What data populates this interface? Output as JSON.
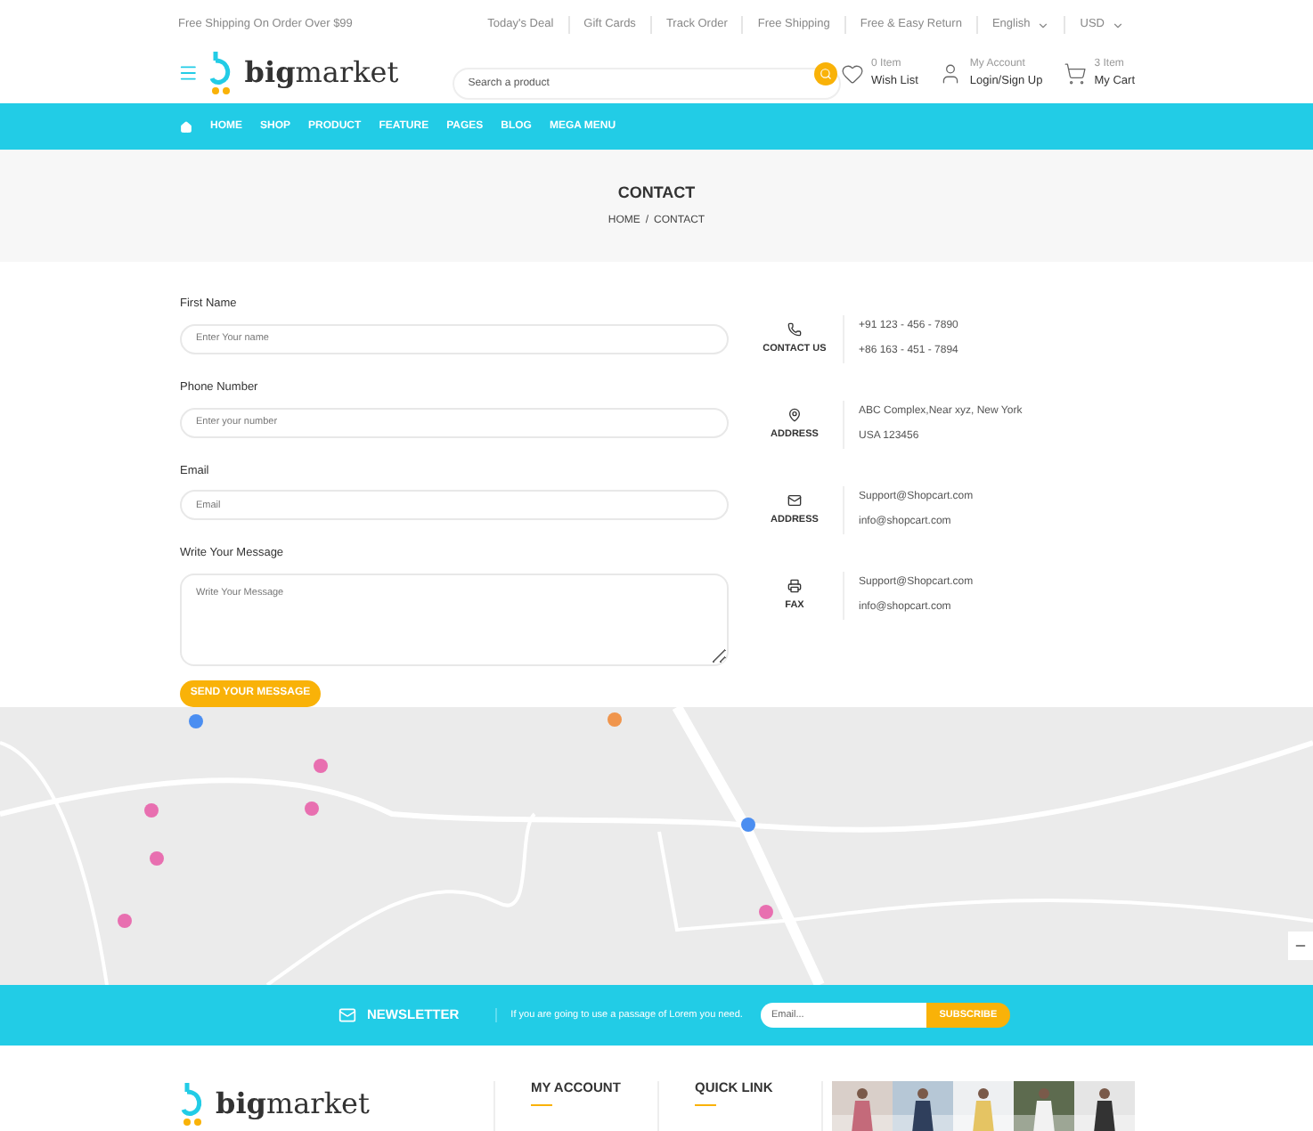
{
  "top_bar": {
    "promo": "Free Shipping On Order Over $99",
    "links": [
      "Today's Deal",
      "Gift Cards",
      "Track Order",
      "Free Shipping",
      "Free & Easy Return"
    ],
    "language": "English",
    "currency": "USD"
  },
  "header": {
    "logo": "**big**market",
    "search": {
      "placeholder": "Search a product"
    },
    "actions": [
      {
        "kind": "heart",
        "top": "0 Item",
        "label": "Wish List"
      },
      {
        "kind": "user",
        "top": "My Account",
        "label": "Login/Sign Up"
      },
      {
        "kind": "cart",
        "top": "3 Item",
        "label": "My Cart"
      }
    ]
  },
  "nav": [
    "HOME",
    "SHOP",
    "PRODUCT",
    "FEATURE",
    "PAGES",
    "BLOG",
    "MEGA MENU"
  ],
  "page_title": "CONTACT",
  "breadcrumb": [
    "HOME",
    "/",
    "CONTACT"
  ],
  "form": {
    "fields": [
      {
        "kind": "input",
        "label": "First Name",
        "placeholder": "Enter Your name"
      },
      {
        "kind": "input",
        "label": "Phone Number",
        "placeholder": "Enter your number"
      },
      {
        "kind": "input",
        "label": "Email",
        "placeholder": "Email"
      },
      {
        "kind": "textarea",
        "label": "Write Your Message",
        "placeholder": "Write Your Message"
      }
    ],
    "submit": "SEND YOUR MESSAGE"
  },
  "contact_info": [
    {
      "kind": "phone",
      "title": "CONTACT US",
      "lines": [
        "+91 123 - 456 - 7890",
        "+86 163 - 451 - 7894"
      ]
    },
    {
      "kind": "pin",
      "title": "ADDRESS",
      "lines": [
        "ABC Complex,Near xyz, New York",
        "USA 123456"
      ]
    },
    {
      "kind": "mail",
      "title": "ADDRESS",
      "lines": [
        "Support@Shopcart.com",
        "info@shopcart.com"
      ]
    },
    {
      "kind": "fax",
      "title": "FAX",
      "lines": [
        "Support@Shopcart.com",
        "info@shopcart.com"
      ]
    }
  ],
  "map": {
    "kind": "picture"
  },
  "newsletter": {
    "title": "NEWSLETTER",
    "text": "If you are going to use a passage of Lorem you need.",
    "placeholder": "Email...",
    "button": "SUBSCRIBE"
  },
  "footer": {
    "logo": "**big**market",
    "columns": [
      "MY ACCOUNT",
      "QUICK LINK"
    ],
    "photos": [
      {
        "kind": "picture"
      },
      {
        "kind": "picture"
      },
      {
        "kind": "picture"
      },
      {
        "kind": "picture"
      },
      {
        "kind": "picture"
      }
    ]
  }
}
